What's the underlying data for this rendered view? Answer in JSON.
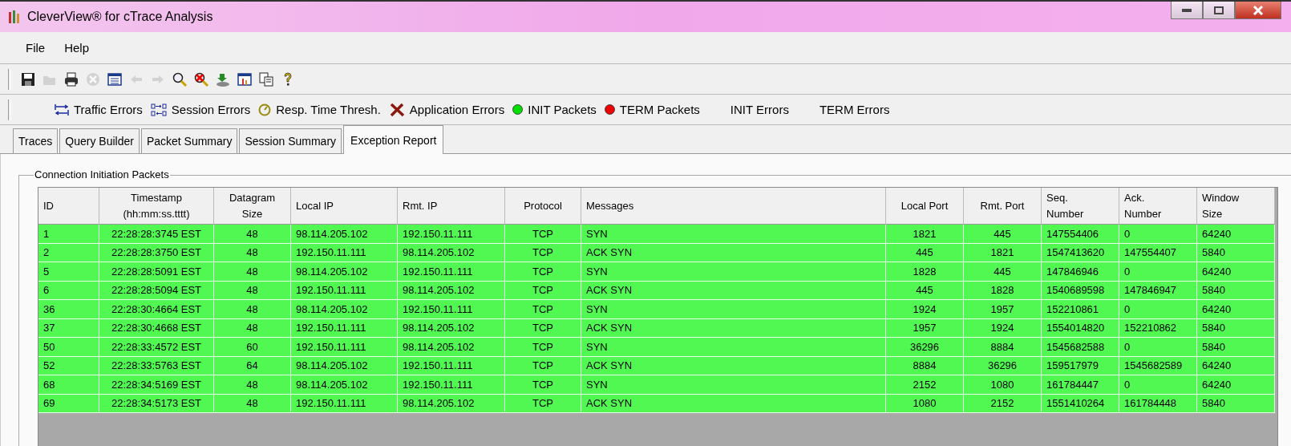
{
  "window": {
    "title": "CleverView® for cTrace Analysis"
  },
  "menu": [
    "File",
    "Help"
  ],
  "toolbar": [
    {
      "kind": "save",
      "disabled": false
    },
    {
      "kind": "open",
      "disabled": true
    },
    {
      "kind": "print",
      "disabled": false
    },
    {
      "kind": "stop",
      "disabled": true
    },
    {
      "kind": "list",
      "disabled": false
    },
    {
      "kind": "back",
      "disabled": true
    },
    {
      "kind": "forward",
      "disabled": true
    },
    {
      "kind": "search",
      "disabled": false
    },
    {
      "kind": "clear-search",
      "disabled": false
    },
    {
      "kind": "import",
      "disabled": false
    },
    {
      "kind": "chart",
      "disabled": false
    },
    {
      "kind": "copy",
      "disabled": false
    },
    {
      "kind": "help",
      "disabled": false
    }
  ],
  "filters": [
    {
      "kind": "traffic",
      "label": "Traffic Errors"
    },
    {
      "kind": "session",
      "label": "Session Errors"
    },
    {
      "kind": "clock",
      "label": "Resp. Time Thresh."
    },
    {
      "kind": "tools",
      "label": "Application Errors"
    },
    {
      "kind": "dot",
      "color": "#00dd00",
      "label": "INIT Packets"
    },
    {
      "kind": "dot",
      "color": "#ee0000",
      "label": "TERM Packets"
    },
    {
      "kind": "text",
      "label": "INIT Errors"
    },
    {
      "kind": "text",
      "label": "TERM Errors"
    }
  ],
  "tabs": [
    {
      "label": "Traces",
      "selected": false
    },
    {
      "label": "Query Builder",
      "selected": false
    },
    {
      "label": "Packet Summary",
      "selected": false
    },
    {
      "label": "Session Summary",
      "selected": false
    },
    {
      "label": "Exception Report",
      "selected": true
    }
  ],
  "group": {
    "title": "Connection Initiation Packets"
  },
  "table": {
    "columns": [
      "ID",
      "Timestamp\n(hh:mm:ss.tttt)",
      "Datagram\nSize",
      "Local IP",
      "Rmt. IP",
      "Protocol",
      "Messages",
      "Local Port",
      "Rmt. Port",
      "Seq.\nNumber",
      "Ack.\nNumber",
      "Window\nSize"
    ],
    "rows": [
      [
        "1",
        "22:28:28:3745 EST",
        "48",
        "98.114.205.102",
        "192.150.11.111",
        "TCP",
        "SYN",
        "1821",
        "445",
        "147554406",
        "0",
        "64240"
      ],
      [
        "2",
        "22:28:28:3750 EST",
        "48",
        "192.150.11.111",
        "98.114.205.102",
        "TCP",
        "ACK SYN",
        "445",
        "1821",
        "1547413620",
        "147554407",
        "5840"
      ],
      [
        "5",
        "22:28:28:5091 EST",
        "48",
        "98.114.205.102",
        "192.150.11.111",
        "TCP",
        "SYN",
        "1828",
        "445",
        "147846946",
        "0",
        "64240"
      ],
      [
        "6",
        "22:28:28:5094 EST",
        "48",
        "192.150.11.111",
        "98.114.205.102",
        "TCP",
        "ACK SYN",
        "445",
        "1828",
        "1540689598",
        "147846947",
        "5840"
      ],
      [
        "36",
        "22:28:30:4664 EST",
        "48",
        "98.114.205.102",
        "192.150.11.111",
        "TCP",
        "SYN",
        "1924",
        "1957",
        "152210861",
        "0",
        "64240"
      ],
      [
        "37",
        "22:28:30:4668 EST",
        "48",
        "192.150.11.111",
        "98.114.205.102",
        "TCP",
        "ACK SYN",
        "1957",
        "1924",
        "1554014820",
        "152210862",
        "5840"
      ],
      [
        "50",
        "22:28:33:4572 EST",
        "60",
        "192.150.11.111",
        "98.114.205.102",
        "TCP",
        "SYN",
        "36296",
        "8884",
        "1545682588",
        "0",
        "5840"
      ],
      [
        "52",
        "22:28:33:5763 EST",
        "64",
        "98.114.205.102",
        "192.150.11.111",
        "TCP",
        "ACK SYN",
        "8884",
        "36296",
        "159517979",
        "1545682589",
        "64240"
      ],
      [
        "68",
        "22:28:34:5169 EST",
        "48",
        "98.114.205.102",
        "192.150.11.111",
        "TCP",
        "SYN",
        "2152",
        "1080",
        "161784447",
        "0",
        "64240"
      ],
      [
        "69",
        "22:28:34:5173 EST",
        "48",
        "192.150.11.111",
        "98.114.205.102",
        "TCP",
        "ACK SYN",
        "1080",
        "2152",
        "1551410264",
        "161784448",
        "5840"
      ]
    ]
  }
}
